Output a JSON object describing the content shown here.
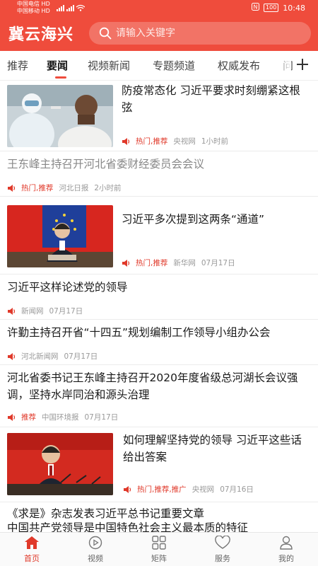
{
  "status_bar": {
    "carrier1": "中国电信",
    "carrier2": "中国移动",
    "carrier_badge": "HD",
    "battery": "100",
    "time": "10:48"
  },
  "header": {
    "title": "冀云海兴",
    "search_placeholder": "请输入关键字"
  },
  "tabs": [
    "推荐",
    "要闻",
    "视频新闻",
    "专题频道",
    "权威发布",
    "问"
  ],
  "active_tab": 1,
  "colors": {
    "accent": "#ef4c3c",
    "tag": "#e0392a"
  },
  "feed": [
    {
      "title": "防疫常态化 习近平要求时刻绷紧这根弦",
      "tag": "热门,推荐",
      "source": "央视网",
      "time": "1小时前",
      "thumb": "epidemic-test-photo"
    },
    {
      "title": "王东峰主持召开河北省委财经委员会会议",
      "tag": "热门,推荐",
      "source": "河北日报",
      "time": "2小时前"
    },
    {
      "title": "习近平多次提到这两条“通道”",
      "tag": "热门,推荐",
      "source": "新华网",
      "time": "07月17日",
      "thumb": "video-meeting-photo"
    },
    {
      "title": "习近平这样论述党的领导",
      "tag": "",
      "source": "新闻网",
      "time": "07月17日"
    },
    {
      "title": "许勤主持召开省“十四五”规划编制工作领导小组办公会",
      "tag": "",
      "source": "河北新闻网",
      "time": "07月17日"
    },
    {
      "title": "河北省委书记王东峰主持召开2020年度省级总河湖长会议强调，坚持水岸同治和源头治理",
      "tag": "推荐",
      "source": "中国环境报",
      "time": "07月17日"
    },
    {
      "title": "如何理解坚持党的领导 习近平这些话给出答案",
      "tag": "热门,推荐,推广",
      "source": "央视网",
      "time": "07月16日",
      "thumb": "speech-photo"
    },
    {
      "title": "《求是》杂志发表习近平总书记重要文章",
      "title2": "中国共产党领导是中国特色社会主义最本质的特征"
    }
  ],
  "bottom_nav": [
    {
      "label": "首页",
      "icon": "home-icon"
    },
    {
      "label": "视频",
      "icon": "play-icon"
    },
    {
      "label": "矩阵",
      "icon": "grid-icon"
    },
    {
      "label": "服务",
      "icon": "heart-icon"
    },
    {
      "label": "我的",
      "icon": "user-icon"
    }
  ],
  "active_nav": 0
}
